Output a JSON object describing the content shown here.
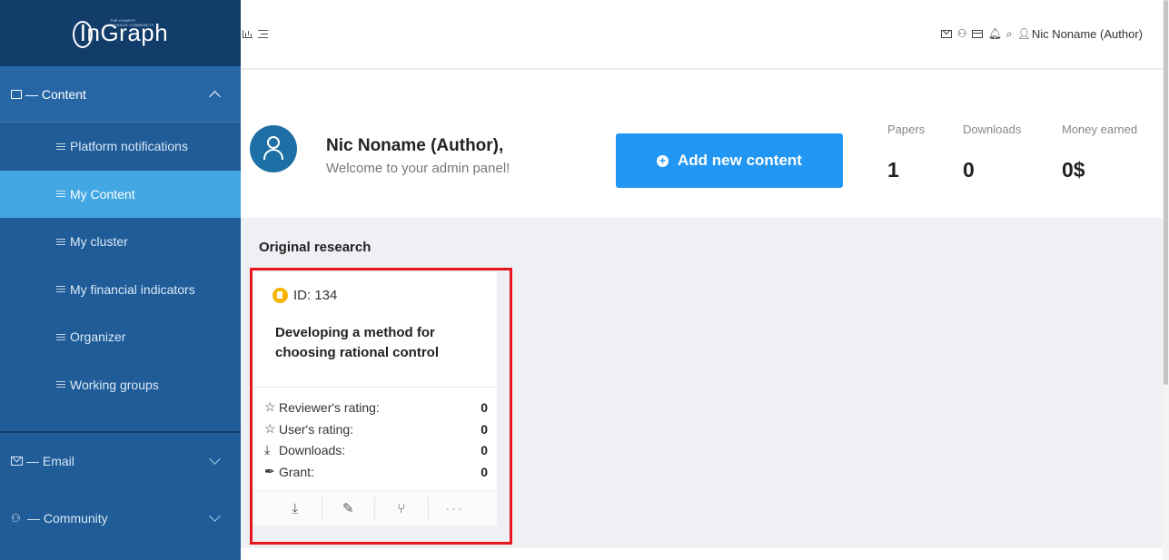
{
  "app": {
    "logo_text": "InGraph",
    "logo_tagline": "THE HONEST\nSCIENCE COMMUNITY"
  },
  "sidebar": {
    "content_section": {
      "label": "— Content"
    },
    "items": [
      {
        "label": "Platform notifications"
      },
      {
        "label": "My Content",
        "active": true
      },
      {
        "label": "My cluster"
      },
      {
        "label": "My financial indicators"
      },
      {
        "label": "Organizer"
      },
      {
        "label": "Working groups"
      }
    ],
    "email_section": {
      "label": "— Email"
    },
    "community_section": {
      "label": "— Community"
    }
  },
  "topbar": {
    "user_name": "Nic Noname (Author)"
  },
  "header": {
    "welcome_name": "Nic Noname (Author),",
    "welcome_sub": "Welcome to your admin panel!",
    "add_button": "Add new content",
    "stats": [
      {
        "label": "Papers",
        "value": "1"
      },
      {
        "label": "Downloads",
        "value": "0"
      },
      {
        "label": "Money earned",
        "value": "0$"
      }
    ]
  },
  "content": {
    "section_title": "Original research",
    "card": {
      "id_label": "ID: 134",
      "title": "Developing a method for choosing rational control",
      "metrics": [
        {
          "label": "Reviewer's rating:",
          "value": "0",
          "icon": "star-icon"
        },
        {
          "label": "User's rating:",
          "value": "0",
          "icon": "star-icon"
        },
        {
          "label": "Downloads:",
          "value": "0",
          "icon": "download-icon"
        },
        {
          "label": "Grant:",
          "value": "0",
          "icon": "paperclip-icon"
        }
      ]
    }
  },
  "colors": {
    "sidebar": "#1f5c98",
    "sidebar_logo": "#123d6b",
    "active_item": "#42a7e2",
    "primary_button": "#2196f3",
    "highlight_border": "#e8171f",
    "avatar": "#1d6fa5",
    "doc_badge": "#f7b500"
  }
}
